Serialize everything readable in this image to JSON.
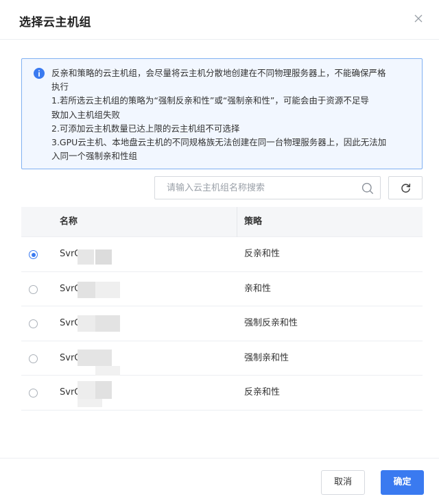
{
  "dialog": {
    "title": "选择云主机组",
    "close_icon": "close-icon"
  },
  "notice": {
    "icon": "info-icon",
    "accent_color": "#3a7af0",
    "lines": [
      "反亲和策略的云主机组，会尽量将云主机分散地创建在不同物理服务器上，不能确保严格",
      "执行",
      "1.若所选云主机组的策略为“强制反亲和性”或“强制亲和性”，可能会由于资源不足导",
      "致加入主机组失败",
      "2.可添加云主机数量已达上限的云主机组不可选择",
      "3.GPU云主机、本地盘云主机的不同规格族无法创建在同一台物理服务器上，因此无法加",
      "入同一个强制亲和性组"
    ]
  },
  "search": {
    "placeholder": "请输入云主机组名称搜索",
    "value": "",
    "icon": "search-icon",
    "refresh_icon": "refresh-icon"
  },
  "table": {
    "columns": [
      "名称",
      "策略"
    ],
    "rows": [
      {
        "name": "SvrG",
        "policy": "反亲和性",
        "selected": true
      },
      {
        "name": "SvrG",
        "policy": "亲和性",
        "selected": false
      },
      {
        "name": "SvrG",
        "policy": "强制反亲和性",
        "selected": false
      },
      {
        "name": "SvrG",
        "policy": "强制亲和性",
        "selected": false
      },
      {
        "name": "SvrG",
        "policy": "反亲和性",
        "selected": false
      }
    ]
  },
  "footer": {
    "cancel_label": "取消",
    "ok_label": "确定"
  }
}
